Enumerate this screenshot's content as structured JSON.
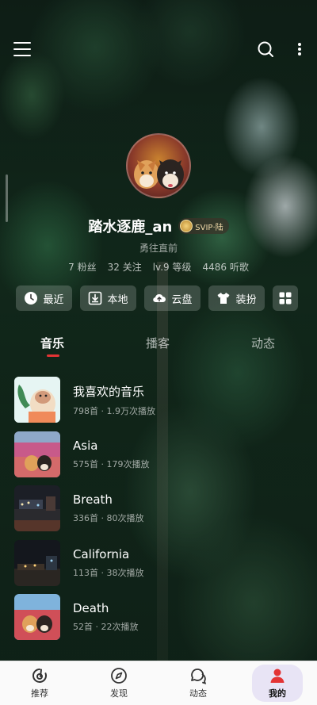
{
  "header": {
    "menu_icon": "menu-icon",
    "search_icon": "search-icon",
    "more_icon": "more-vertical-icon"
  },
  "profile": {
    "username": "踏水逐鹿_an",
    "badge": "SVIP·陆",
    "signature": "勇往直前",
    "stats": {
      "fans": "7 粉丝",
      "following": "32 关注",
      "level": "lv.9 等级",
      "listened": "4486 听歌"
    }
  },
  "shortcuts": [
    {
      "label": "最近",
      "icon": "clock-icon"
    },
    {
      "label": "本地",
      "icon": "download-box-icon"
    },
    {
      "label": "云盘",
      "icon": "cloud-upload-icon"
    },
    {
      "label": "装扮",
      "icon": "tshirt-icon"
    },
    {
      "label": "",
      "icon": "grid-icon"
    }
  ],
  "tabs": [
    {
      "label": "音乐",
      "active": true
    },
    {
      "label": "播客",
      "active": false
    },
    {
      "label": "动态",
      "active": false
    }
  ],
  "playlists": [
    {
      "title": "我喜欢的音乐",
      "meta": "798首 · 1.9万次播放"
    },
    {
      "title": "Asia",
      "meta": "575首 · 179次播放"
    },
    {
      "title": "Breath",
      "meta": "336首 · 80次播放"
    },
    {
      "title": "California",
      "meta": "113首 · 38次播放"
    },
    {
      "title": "Death",
      "meta": "52首 · 22次播放"
    }
  ],
  "bottom_nav": [
    {
      "label": "推荐",
      "icon": "netease-logo-icon",
      "active": false
    },
    {
      "label": "发现",
      "icon": "compass-icon",
      "active": false
    },
    {
      "label": "动态",
      "icon": "chat-bubbles-icon",
      "active": false
    },
    {
      "label": "我的",
      "icon": "user-icon",
      "active": true
    }
  ],
  "colors": {
    "accent_red": "#e33434",
    "nav_active_bg": "#e8e4f5"
  }
}
